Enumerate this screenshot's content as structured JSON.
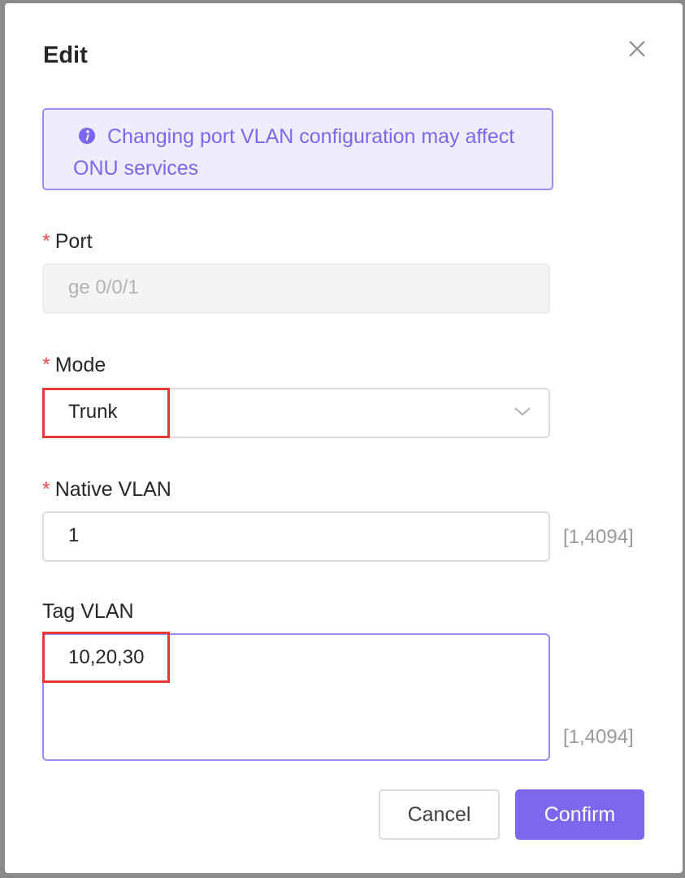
{
  "dialog": {
    "title": "Edit"
  },
  "alert": {
    "message": "Changing port VLAN configuration may affect ONU services"
  },
  "form": {
    "port": {
      "label": "Port",
      "value": "ge 0/0/1",
      "required": true
    },
    "mode": {
      "label": "Mode",
      "value": "Trunk",
      "required": true
    },
    "native_vlan": {
      "label": "Native VLAN",
      "value": "1",
      "range_hint": "[1,4094]",
      "required": true
    },
    "tag_vlan": {
      "label": "Tag VLAN",
      "value": "10,20,30",
      "range_hint": "[1,4094]",
      "required": false
    }
  },
  "buttons": {
    "cancel": "Cancel",
    "confirm": "Confirm"
  },
  "required_marker": "*",
  "colors": {
    "accent": "#7b68ee",
    "alert_bg": "#efecfd",
    "required": "#e34d4d",
    "highlight_box": "#e53935"
  },
  "icons": {
    "close": "close-icon",
    "info": "info-icon",
    "dropdown": "chevron-down-icon"
  }
}
